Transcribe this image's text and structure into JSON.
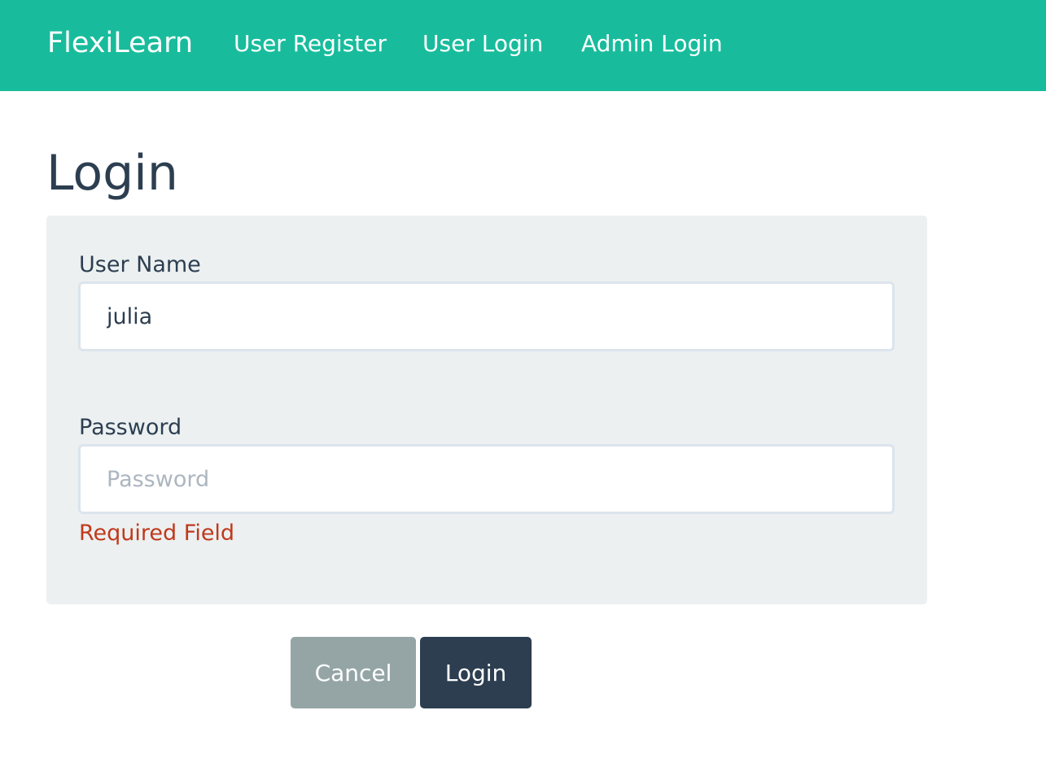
{
  "navbar": {
    "brand": "FlexiLearn",
    "links": [
      "User Register",
      "User Login",
      "Admin Login"
    ],
    "background_color": "#18bc9c"
  },
  "page": {
    "title": "Login"
  },
  "form": {
    "username": {
      "label": "User Name",
      "value": "julia",
      "placeholder": ""
    },
    "password": {
      "label": "Password",
      "value": "",
      "placeholder": "Password",
      "error": "Required Field",
      "error_color": "#c0391b"
    },
    "buttons": {
      "cancel": "Cancel",
      "login": "Login"
    }
  }
}
